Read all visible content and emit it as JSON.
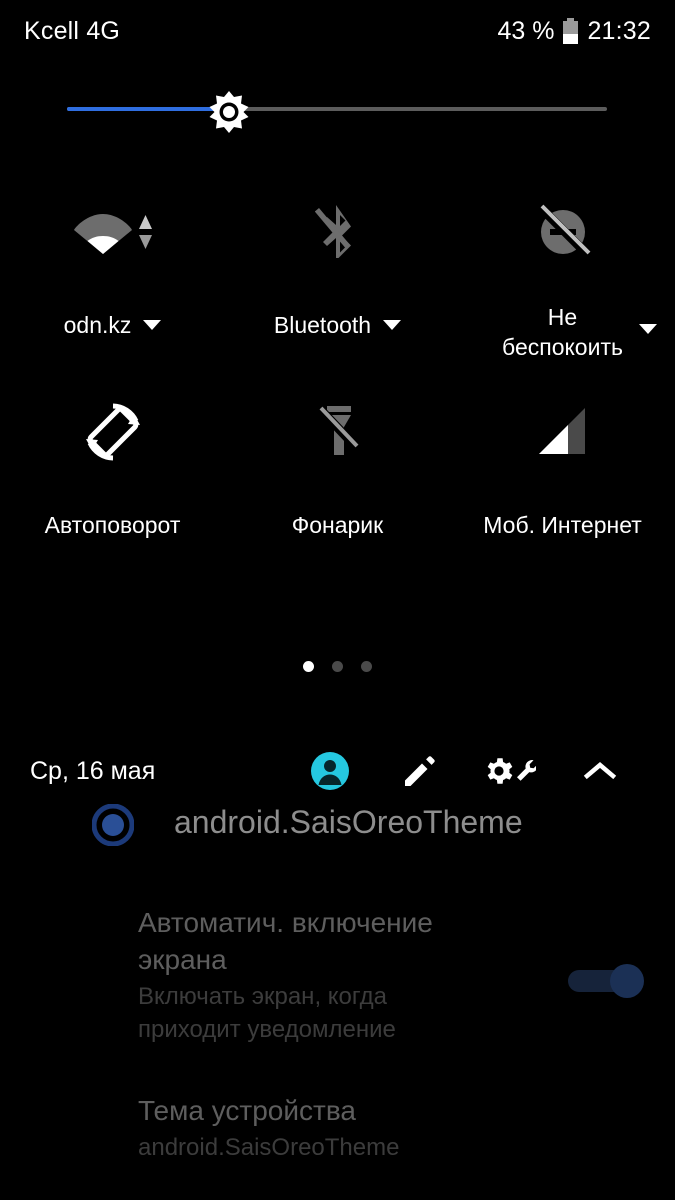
{
  "status_bar": {
    "carrier": "Kcell 4G",
    "battery_percent": "43 %",
    "battery_level": 43,
    "battery_icon": "battery-icon",
    "time": "21:32"
  },
  "brightness": {
    "icon": "brightness-sun-icon",
    "value_percent": 30,
    "fill_color": "#2f6ee0",
    "track_color": "#5c5c5c"
  },
  "tiles": [
    {
      "id": "wifi",
      "icon": "wifi-signal-icon",
      "label": "odn.kz",
      "has_caret": true,
      "enabled": true
    },
    {
      "id": "bluetooth",
      "icon": "bluetooth-off-icon",
      "label": "Bluetooth",
      "has_caret": true,
      "enabled": false
    },
    {
      "id": "do-not-disturb",
      "icon": "do-not-disturb-off-icon",
      "label": "Не беспокоить",
      "label_line1": "Не",
      "label_line2": "беспокоить",
      "has_caret": true,
      "enabled": false
    },
    {
      "id": "auto-rotate",
      "icon": "screen-rotation-icon",
      "label": "Автоповорот",
      "has_caret": false,
      "enabled": true
    },
    {
      "id": "flashlight",
      "icon": "flashlight-off-icon",
      "label": "Фонарик",
      "has_caret": false,
      "enabled": false
    },
    {
      "id": "mobile-data",
      "icon": "mobile-signal-icon",
      "label": "Моб. Интернет",
      "has_caret": false,
      "enabled": true
    }
  ],
  "pager": {
    "total_pages": 3,
    "active_page": 1
  },
  "footer": {
    "date": "Ср, 16 мая",
    "actions": [
      {
        "id": "user",
        "icon": "user-avatar-icon",
        "color": "#25c8e0"
      },
      {
        "id": "edit",
        "icon": "pencil-edit-icon",
        "color": "#ffffff"
      },
      {
        "id": "settings",
        "icon": "gear-wrench-icon",
        "color": "#ffffff"
      },
      {
        "id": "collapse",
        "icon": "chevron-up-icon",
        "color": "#ffffff"
      }
    ]
  },
  "background_screen": {
    "header_text": "android.SaisOreoTheme",
    "header_icon": "theme-circle-icon",
    "items": [
      {
        "title": "Автоматич. включение экрана",
        "subtitle": "Включать экран, когда приходит уведомление",
        "toggle": "on",
        "toggle_color": "#1b3055"
      },
      {
        "title": "Тема устройства",
        "subtitle": "android.SaisOreoTheme",
        "toggle": null
      }
    ]
  }
}
